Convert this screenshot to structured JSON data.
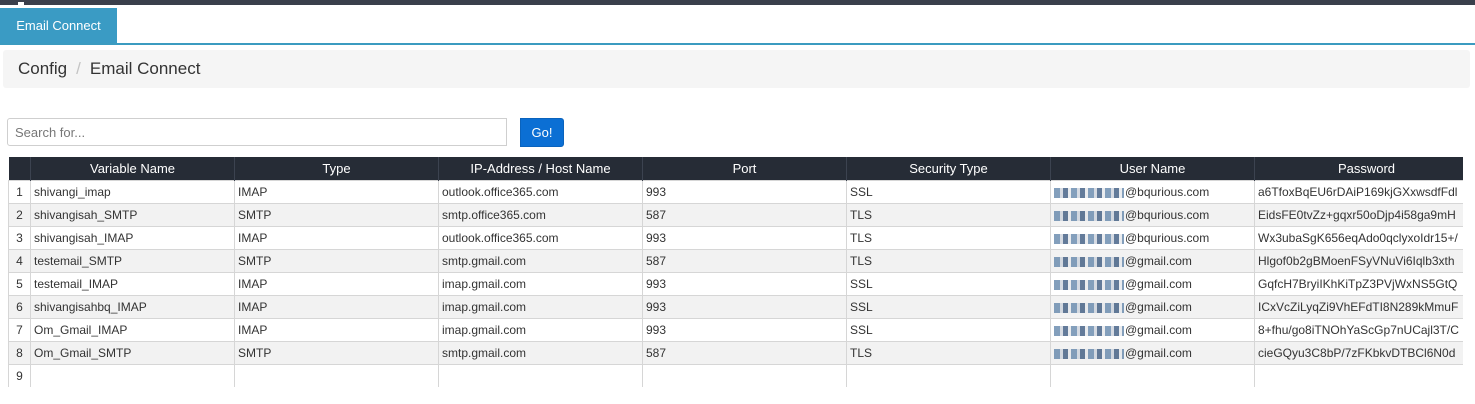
{
  "tabs": [
    {
      "label": "Email Connect"
    }
  ],
  "breadcrumb": {
    "root": "Config",
    "separator": "/",
    "current": "Email Connect"
  },
  "search": {
    "placeholder": "Search for...",
    "value": "",
    "button_label": "Go!"
  },
  "table": {
    "columns": [
      "Variable Name",
      "Type",
      "IP-Address / Host Name",
      "Port",
      "Security Type",
      "User Name",
      "Password"
    ],
    "rows": [
      {
        "num": "1",
        "variable": "shivangi_imap",
        "type": "IMAP",
        "host": "outlook.office365.com",
        "port": "993",
        "security": "SSL",
        "user_suffix": "@bqurious.com",
        "password": "a6TfoxBqEU6rDAiP169kjGXxwsdfFdl"
      },
      {
        "num": "2",
        "variable": "shivangisah_SMTP",
        "type": "SMTP",
        "host": "smtp.office365.com",
        "port": "587",
        "security": "TLS",
        "user_suffix": "@bqurious.com",
        "password": "EidsFE0tvZz+gqxr50oDjp4i58ga9mH"
      },
      {
        "num": "3",
        "variable": "shivangisah_IMAP",
        "type": "IMAP",
        "host": "outlook.office365.com",
        "port": "993",
        "security": "TLS",
        "user_suffix": "@bqurious.com",
        "password": "Wx3ubaSgK656eqAdo0qclyxoIdr15+/"
      },
      {
        "num": "4",
        "variable": "testemail_SMTP",
        "type": "SMTP",
        "host": "smtp.gmail.com",
        "port": "587",
        "security": "TLS",
        "user_suffix": "@gmail.com",
        "password": "Hlgof0b2gBMoenFSyVNuVi6Iqlb3xth"
      },
      {
        "num": "5",
        "variable": "testemail_IMAP",
        "type": "IMAP",
        "host": "imap.gmail.com",
        "port": "993",
        "security": "SSL",
        "user_suffix": "@gmail.com",
        "password": "GqfcH7BryiIKhKiTpZ3PVjWxNS5GtQ"
      },
      {
        "num": "6",
        "variable": "shivangisahbq_IMAP",
        "type": "IMAP",
        "host": "imap.gmail.com",
        "port": "993",
        "security": "SSL",
        "user_suffix": "@gmail.com",
        "password": "ICxVcZiLyqZi9VhEFdTI8N289kMmuF"
      },
      {
        "num": "7",
        "variable": "Om_Gmail_IMAP",
        "type": "IMAP",
        "host": "imap.gmail.com",
        "port": "993",
        "security": "SSL",
        "user_suffix": "@gmail.com",
        "password": "8+fhu/go8iTNOhYaScGp7nUCajl3T/C"
      },
      {
        "num": "8",
        "variable": "Om_Gmail_SMTP",
        "type": "SMTP",
        "host": "smtp.gmail.com",
        "port": "587",
        "security": "TLS",
        "user_suffix": "@gmail.com",
        "password": "cieGQyu3C8bP/7zFKbkvDTBCl6N0d"
      },
      {
        "num": "9",
        "variable": "",
        "type": "",
        "host": "",
        "port": "",
        "security": "",
        "user_suffix": "",
        "password": ""
      }
    ]
  },
  "colors": {
    "tab_active": "#3a9bc4",
    "header_bg": "#262c36",
    "go_button": "#0b6fd4",
    "top_bar": "#3a3f4b"
  }
}
